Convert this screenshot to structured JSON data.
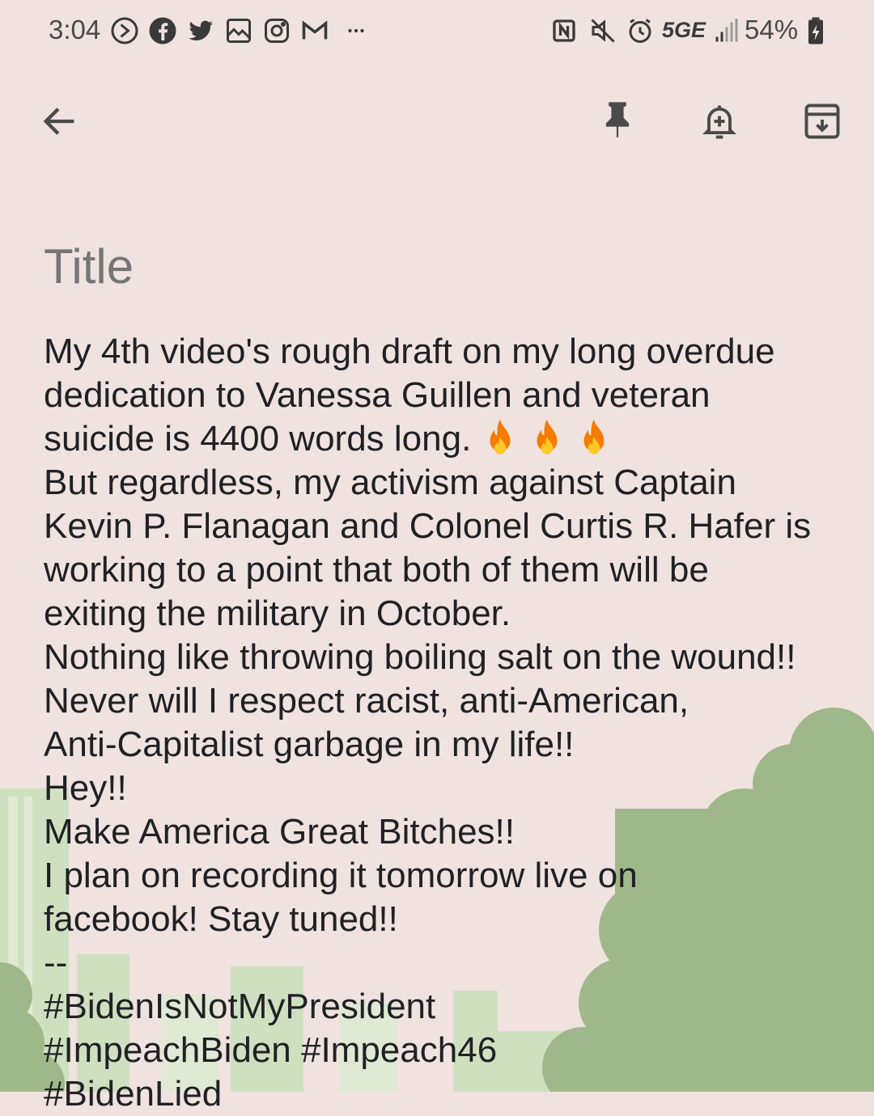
{
  "status_bar": {
    "time": "3:04",
    "network": "5GE",
    "battery": "54%",
    "notification_icons": [
      "pocket-casts-icon",
      "facebook-icon",
      "twitter-icon",
      "gallery-icon",
      "instagram-icon",
      "gmail-icon",
      "more-icon"
    ],
    "system_icons": [
      "nfc-icon",
      "mute-icon",
      "alarm-icon",
      "signal-icon",
      "battery-icon"
    ]
  },
  "toolbar": {
    "back_icon": "arrow-left-icon",
    "pin_icon": "pin-icon",
    "reminder_icon": "bell-plus-icon",
    "archive_icon": "archive-icon"
  },
  "note": {
    "title_placeholder": "Title",
    "lines": [
      "My 4th video's rough draft on my long overdue",
      "dedication to Vanessa Guillen and veteran",
      "suicide is 4400 words long.",
      "But regardless, my activism against Captain",
      "Kevin P. Flanagan and Colonel Curtis R. Hafer is",
      "working to a point that both of them will be",
      "exiting the military in October.",
      "Nothing like throwing boiling salt on the wound!!",
      "Never will I respect racist, anti-American,",
      "Anti-Capitalist garbage in my life!!",
      "Hey!!",
      "Make America Great Bitches!!",
      "I plan on recording it tomorrow live on",
      "facebook! Stay tuned!!",
      "--",
      "#BidenIsNotMyPresident",
      "#ImpeachBiden #Impeach46",
      "#BidenLied"
    ],
    "emoji": "fire-emoji"
  },
  "colors": {
    "background": "#efe2df",
    "art_green": "#9fb889",
    "text": "#202124",
    "placeholder": "#8a8a8a"
  }
}
